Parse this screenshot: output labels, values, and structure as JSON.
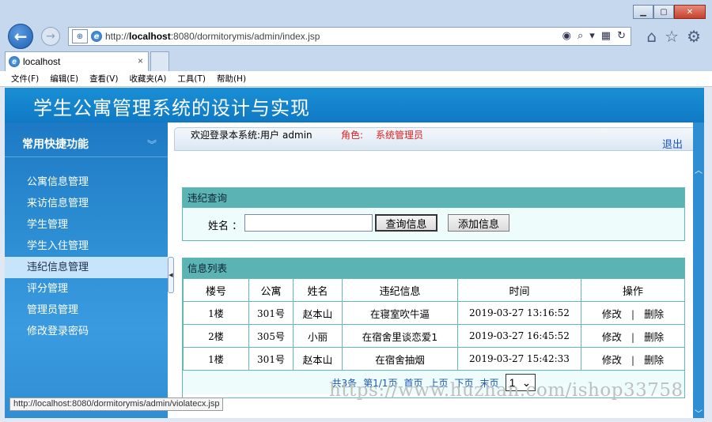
{
  "browser": {
    "url_prefix": "http://",
    "url_host": "localhost",
    "url_rest": ":8080/dormitorymis/admin/index.jsp",
    "tab_title": "localhost",
    "tab_close": "×",
    "menu": [
      "文件(F)",
      "编辑(E)",
      "查看(V)",
      "收藏夹(A)",
      "工具(T)",
      "帮助(H)"
    ],
    "status_url": "http://localhost:8080/dormitorymis/admin/violatecx.jsp"
  },
  "banner": {
    "title": "学生公寓管理系统的设计与实现"
  },
  "sidebar": {
    "heading": "常用快捷功能",
    "items": [
      {
        "label": "公寓信息管理",
        "active": false
      },
      {
        "label": "来访信息管理",
        "active": false
      },
      {
        "label": "学生管理",
        "active": false
      },
      {
        "label": "学生入住管理",
        "active": false
      },
      {
        "label": "违纪信息管理",
        "active": true
      },
      {
        "label": "评分管理",
        "active": false
      },
      {
        "label": "管理员管理",
        "active": false
      },
      {
        "label": "修改登录密码",
        "active": false
      }
    ]
  },
  "topbar": {
    "welcome": "欢迎登录本系统:用户",
    "username": "admin",
    "role_label": "角色:",
    "role_value": "系统管理员",
    "logout": "退出"
  },
  "query": {
    "title": "违纪查询",
    "name_label": "姓名 ：",
    "name_value": "",
    "search_button": "查询信息",
    "add_button": "添加信息"
  },
  "list": {
    "title": "信息列表",
    "columns": [
      "楼号",
      "公寓",
      "姓名",
      "违纪信息",
      "时间",
      "操作"
    ],
    "rows": [
      {
        "building": "1楼",
        "room": "301号",
        "name": "赵本山",
        "info": "在寝室吹牛逼",
        "time": "2019-03-27 13:16:52",
        "edit": "修改",
        "sep": "|",
        "delete": "删除"
      },
      {
        "building": "2楼",
        "room": "305号",
        "name": "小丽",
        "info": "在宿舍里谈恋爱1",
        "time": "2019-03-27 16:45:52",
        "edit": "修改",
        "sep": "|",
        "delete": "删除"
      },
      {
        "building": "1楼",
        "room": "301号",
        "name": "赵本山",
        "info": "在宿舍抽烟",
        "time": "2019-03-27 15:42:33",
        "edit": "修改",
        "sep": "|",
        "delete": "删除"
      }
    ],
    "pager": {
      "total": "共3条",
      "page_info": "第1/1页",
      "first": "首页",
      "prev": "上页",
      "next": "下页",
      "last": "末页",
      "selected_page": "1"
    }
  },
  "watermark": "https://www.huzhan.com/ishop33758"
}
